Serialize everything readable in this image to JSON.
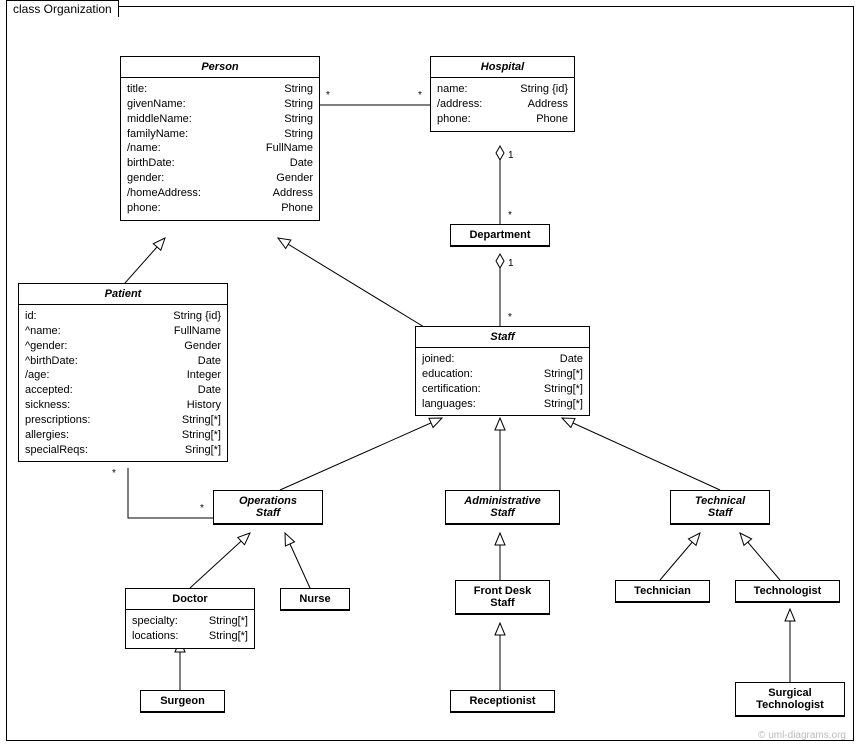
{
  "frame_label": "class Organization",
  "watermark": "© uml-diagrams.org",
  "classes": {
    "person": {
      "title": "Person",
      "attrs": [
        {
          "n": "title:",
          "t": "String"
        },
        {
          "n": "givenName:",
          "t": "String"
        },
        {
          "n": "middleName:",
          "t": "String"
        },
        {
          "n": "familyName:",
          "t": "String"
        },
        {
          "n": "/name:",
          "t": "FullName"
        },
        {
          "n": "birthDate:",
          "t": "Date"
        },
        {
          "n": "gender:",
          "t": "Gender"
        },
        {
          "n": "/homeAddress:",
          "t": "Address"
        },
        {
          "n": "phone:",
          "t": "Phone"
        }
      ]
    },
    "hospital": {
      "title": "Hospital",
      "attrs": [
        {
          "n": "name:",
          "t": "String {id}"
        },
        {
          "n": "/address:",
          "t": "Address"
        },
        {
          "n": "phone:",
          "t": "Phone"
        }
      ]
    },
    "department": {
      "title": "Department"
    },
    "patient": {
      "title": "Patient",
      "attrs": [
        {
          "n": "id:",
          "t": "String {id}"
        },
        {
          "n": "^name:",
          "t": "FullName"
        },
        {
          "n": "^gender:",
          "t": "Gender"
        },
        {
          "n": "^birthDate:",
          "t": "Date"
        },
        {
          "n": "/age:",
          "t": "Integer"
        },
        {
          "n": "accepted:",
          "t": "Date"
        },
        {
          "n": "sickness:",
          "t": "History"
        },
        {
          "n": "prescriptions:",
          "t": "String[*]"
        },
        {
          "n": "allergies:",
          "t": "String[*]"
        },
        {
          "n": "specialReqs:",
          "t": "Sring[*]"
        }
      ]
    },
    "staff": {
      "title": "Staff",
      "attrs": [
        {
          "n": "joined:",
          "t": "Date"
        },
        {
          "n": "education:",
          "t": "String[*]"
        },
        {
          "n": "certification:",
          "t": "String[*]"
        },
        {
          "n": "languages:",
          "t": "String[*]"
        }
      ]
    },
    "opstaff": {
      "title": "Operations",
      "subtitle": "Staff"
    },
    "adminstaff": {
      "title": "Administrative",
      "subtitle": "Staff"
    },
    "techstaff": {
      "title": "Technical",
      "subtitle": "Staff"
    },
    "doctor": {
      "title": "Doctor",
      "attrs": [
        {
          "n": "specialty:",
          "t": "String[*]"
        },
        {
          "n": "locations:",
          "t": "String[*]"
        }
      ]
    },
    "nurse": {
      "title": "Nurse"
    },
    "frontdesk": {
      "title": "Front Desk",
      "subtitle": "Staff"
    },
    "technician": {
      "title": "Technician"
    },
    "technologist": {
      "title": "Technologist"
    },
    "surgeon": {
      "title": "Surgeon"
    },
    "receptionist": {
      "title": "Receptionist"
    },
    "surgtech": {
      "title": "Surgical",
      "subtitle": "Technologist"
    }
  },
  "mults": {
    "ph1": "*",
    "ph2": "*",
    "hd1": "1",
    "hd2": "*",
    "ds1": "1",
    "ds2": "*",
    "po1": "*",
    "po2": "*"
  }
}
